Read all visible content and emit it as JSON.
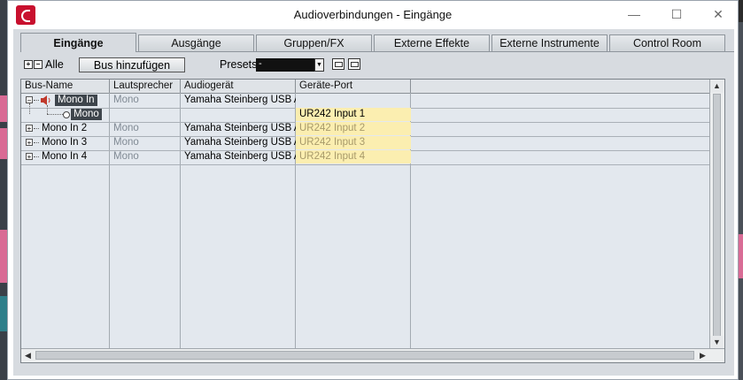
{
  "window": {
    "title": "Audioverbindungen - Eingänge",
    "minimize": "—",
    "maximize": "☐",
    "close": "✕"
  },
  "tabs": [
    {
      "label": "Eingänge",
      "active": true
    },
    {
      "label": "Ausgänge",
      "active": false
    },
    {
      "label": "Gruppen/FX",
      "active": false
    },
    {
      "label": "Externe Effekte",
      "active": false
    },
    {
      "label": "Externe Instrumente",
      "active": false
    },
    {
      "label": "Control Room",
      "active": false
    }
  ],
  "toolbar": {
    "expand_all_icon": "+",
    "collapse_all_icon": "−",
    "all_label": "Alle",
    "add_bus_label": "Bus hinzufügen",
    "presets_label": "Presets",
    "presets_value": "-"
  },
  "table": {
    "headers": [
      "Bus-Name",
      "Lautsprecher",
      "Audiogerät",
      "Geräte-Port"
    ],
    "rows": [
      {
        "name": "Mono In",
        "speaker": "Mono",
        "device": "Yamaha Steinberg USB AS",
        "port": ""
      },
      {
        "name": "Mono",
        "speaker": "",
        "device": "",
        "port": "UR242 Input 1"
      },
      {
        "name": "Mono In 2",
        "speaker": "Mono",
        "device": "Yamaha Steinberg USB AS",
        "port": "UR242 Input 2"
      },
      {
        "name": "Mono In 3",
        "speaker": "Mono",
        "device": "Yamaha Steinberg USB AS",
        "port": "UR242 Input 3"
      },
      {
        "name": "Mono In 4",
        "speaker": "Mono",
        "device": "Yamaha Steinberg USB AS",
        "port": "UR242 Input 4"
      }
    ]
  },
  "colors": {
    "port_highlight": "#fbeeb0",
    "selection": "#3e454c",
    "app_logo": "#c8102e"
  }
}
